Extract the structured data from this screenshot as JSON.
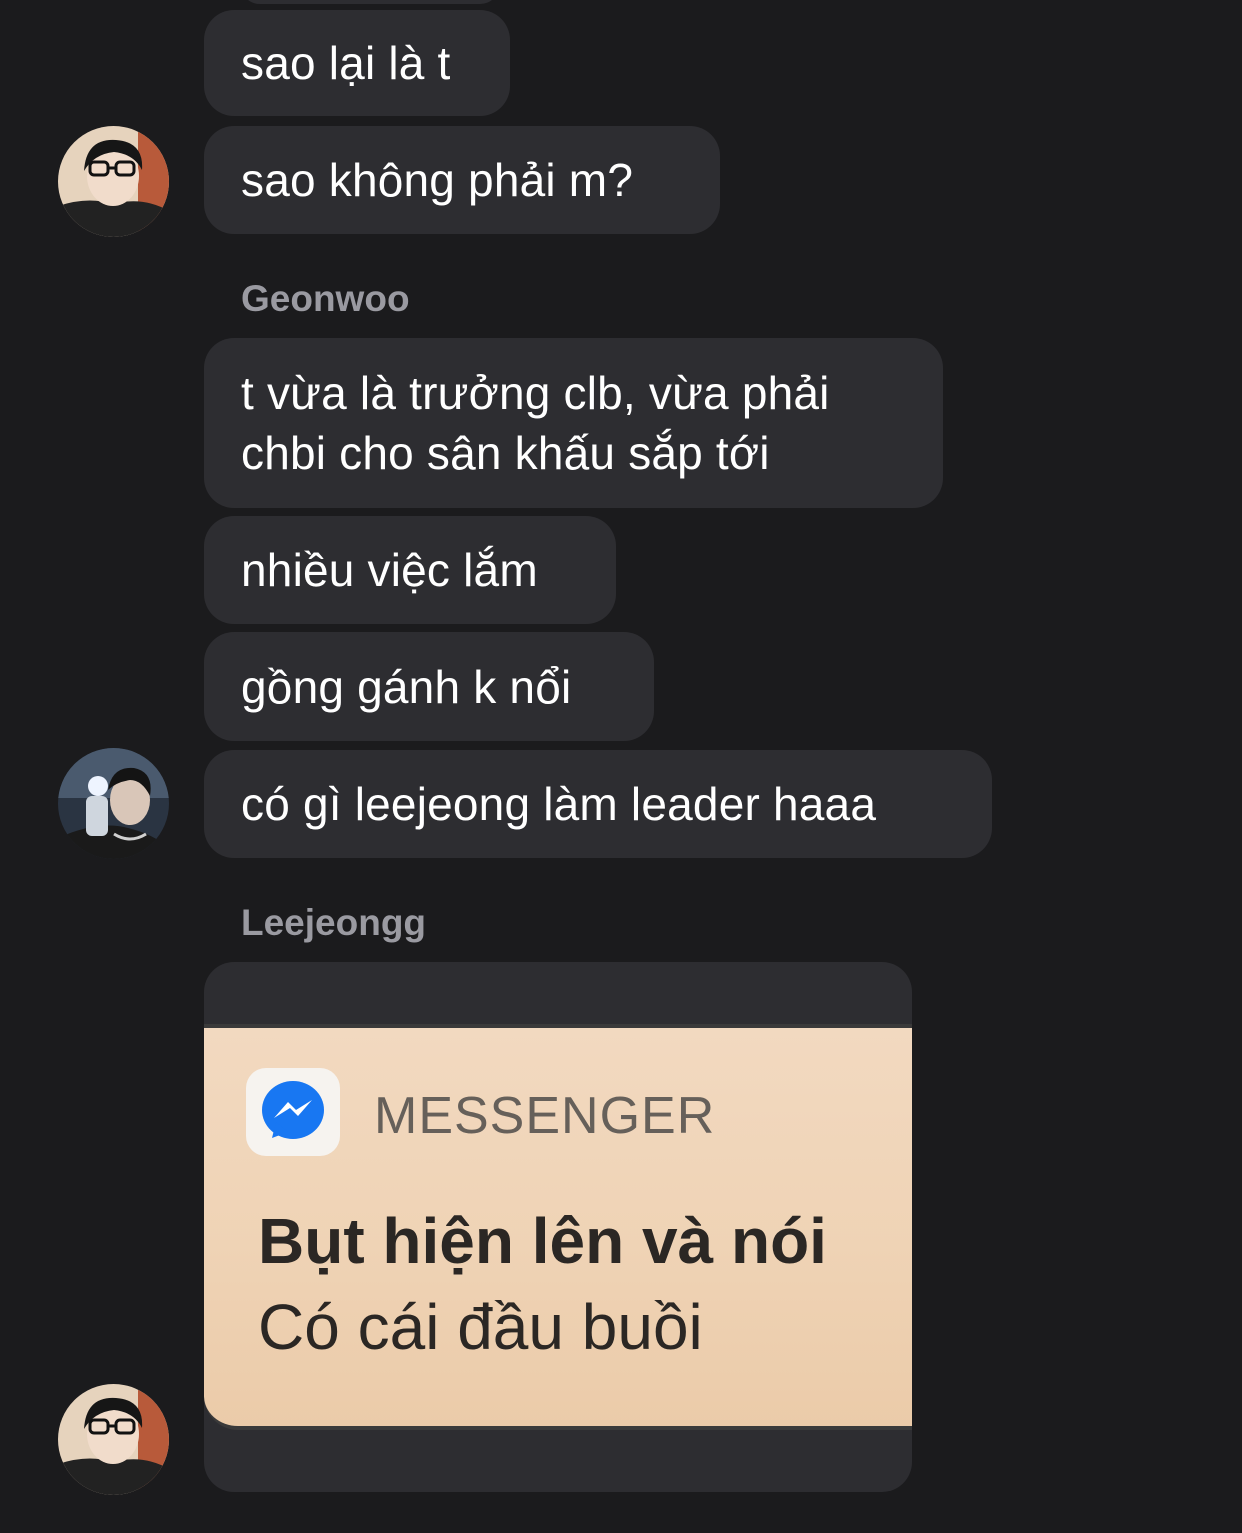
{
  "messages": [
    {
      "text": "sao lại là t"
    },
    {
      "text": "sao không phải m?"
    },
    {
      "text": "t vừa là trưởng clb, vừa phải chbi cho sân khấu sắp tới"
    },
    {
      "text": "nhiều việc lắm"
    },
    {
      "text": "gồng gánh k nổi"
    },
    {
      "text": "có gì leejeong làm leader haaa"
    }
  ],
  "senders": {
    "geonwoo": "Geonwoo",
    "leejeongg": "Leejeongg"
  },
  "image_message": {
    "app_name": "MESSENGER",
    "line1": "Bụt hiện lên và nói",
    "line2": "Có cái đầu buồi",
    "icon": "messenger-icon"
  },
  "colors": {
    "background": "#1b1b1d",
    "bubble": "#2d2d31",
    "sender_name": "#9a9aa1",
    "messenger_blue": "#1877f2"
  }
}
